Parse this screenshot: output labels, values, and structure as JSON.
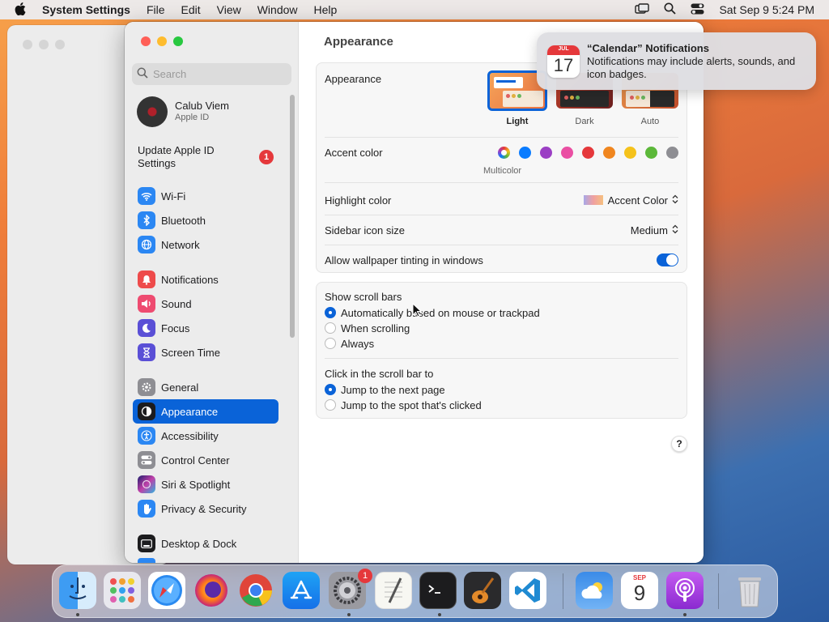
{
  "menubar": {
    "app": "System Settings",
    "items": [
      "File",
      "Edit",
      "View",
      "Window",
      "Help"
    ],
    "clock": "Sat Sep 9  5:24 PM"
  },
  "sidebar": {
    "search_placeholder": "Search",
    "account_name": "Calub Viem",
    "account_sub": "Apple ID",
    "update_label": "Update Apple ID Settings",
    "update_badge": "1",
    "items": [
      {
        "label": "Wi-Fi",
        "color": "#2b87f3"
      },
      {
        "label": "Bluetooth",
        "color": "#2b87f3"
      },
      {
        "label": "Network",
        "color": "#2b87f3"
      },
      {
        "label": "Notifications",
        "color": "#ee4b4b"
      },
      {
        "label": "Sound",
        "color": "#ee4b70"
      },
      {
        "label": "Focus",
        "color": "#5a4fd6"
      },
      {
        "label": "Screen Time",
        "color": "#5a4fd6"
      },
      {
        "label": "General",
        "color": "#8e8e93"
      },
      {
        "label": "Appearance",
        "color": "#1c1c1e"
      },
      {
        "label": "Accessibility",
        "color": "#2b87f3"
      },
      {
        "label": "Control Center",
        "color": "#8e8e93"
      },
      {
        "label": "Siri & Spotlight",
        "color": "#8a3fd1"
      },
      {
        "label": "Privacy & Security",
        "color": "#2b87f3"
      },
      {
        "label": "Desktop & Dock",
        "color": "#1c1c1e"
      }
    ]
  },
  "content": {
    "title": "Appearance",
    "appearance_label": "Appearance",
    "themes": [
      "Light",
      "Dark",
      "Auto"
    ],
    "accent_label": "Accent color",
    "accent_caption": "Multicolor",
    "accent_colors": [
      "#0a7cff",
      "#9b3fc4",
      "#ea4fa3",
      "#e5383b",
      "#f0861f",
      "#f5c21b",
      "#5cb83a",
      "#8e8e93"
    ],
    "highlight_label": "Highlight color",
    "highlight_value": "Accent Color",
    "icon_size_label": "Sidebar icon size",
    "icon_size_value": "Medium",
    "tinting_label": "Allow wallpaper tinting in windows",
    "scroll_title": "Show scroll bars",
    "scroll_options": [
      "Automatically based on mouse or trackpad",
      "When scrolling",
      "Always"
    ],
    "click_title": "Click in the scroll bar to",
    "click_options": [
      "Jump to the next page",
      "Jump to the spot that's clicked"
    ],
    "help": "?"
  },
  "notification": {
    "month": "JUL",
    "day": "17",
    "title": "“Calendar” Notifications",
    "body": "Notifications may include alerts, sounds, and icon badges."
  },
  "dock": {
    "settings_badge": "1",
    "calendar_month": "SEP",
    "calendar_day": "9"
  }
}
